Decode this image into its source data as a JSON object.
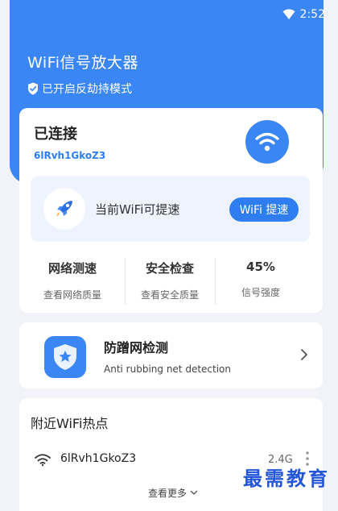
{
  "status_bar": {
    "time": "2:52"
  },
  "header": {
    "app_title": "WiFi信号放大器",
    "anti_hijack_label": "已开启反劫持模式"
  },
  "connection": {
    "status": "已连接",
    "ssid": "6lRvh1GkoZ3",
    "speedup_text": "当前WiFi可提速",
    "speedup_button": "WiFi 提速"
  },
  "stats": [
    {
      "value": "网络测速",
      "label": "查看网络质量"
    },
    {
      "value": "安全检查",
      "label": "查看安全质量"
    },
    {
      "value": "45%",
      "label": "信号强度"
    }
  ],
  "anti_rubbing": {
    "title": "防蹭网检测",
    "subtitle": "Anti rubbing net detection"
  },
  "nearby": {
    "title": "附近WiFi热点",
    "hotspots": [
      {
        "ssid": "6lRvh1GkoZ3",
        "band": "2.4G"
      }
    ],
    "see_more": "查看更多"
  },
  "watermark": "最需教育",
  "colors": {
    "primary": "#3a86f4",
    "accent_text": "#2e7ef2"
  },
  "icons": {
    "status_wifi": "wifi-icon",
    "shield_check": "shield-check-icon",
    "wifi_connected": "wifi-icon",
    "rocket": "rocket-icon",
    "anti_rubbing": "shield-star-icon",
    "chevron_right": "chevron-right-icon",
    "hotspot_wifi": "wifi-icon",
    "more": "more-vertical-icon",
    "see_more_chevron": "chevron-down-icon"
  }
}
